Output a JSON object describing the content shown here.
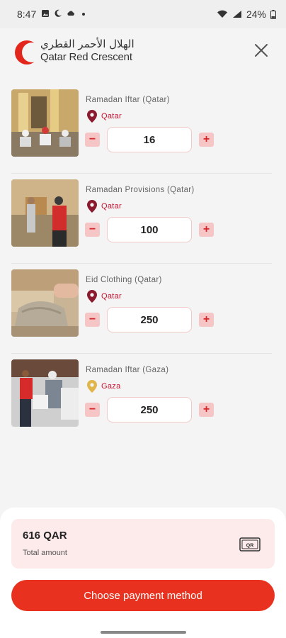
{
  "status_bar": {
    "time": "8:47",
    "battery": "24%"
  },
  "header": {
    "logo_ar": "الهلال الأحمر القطري",
    "logo_en": "Qatar Red Crescent"
  },
  "items": [
    {
      "title": "Ramadan Iftar (Qatar)",
      "location": "Qatar",
      "quantity": "16",
      "pin_color": "#8b1a2e"
    },
    {
      "title": "Ramadan Provisions (Qatar)",
      "location": "Qatar",
      "quantity": "100",
      "pin_color": "#8b1a2e"
    },
    {
      "title": "Eid Clothing (Qatar)",
      "location": "Qatar",
      "quantity": "250",
      "pin_color": "#8b1a2e"
    },
    {
      "title": "Ramadan Iftar (Gaza)",
      "location": "Gaza",
      "quantity": "250",
      "pin_color": "#e0b64b"
    }
  ],
  "summary": {
    "total_amount": "616 QAR",
    "total_label": "Total amount",
    "qr_label": "QR"
  },
  "pay_button": "Choose payment method",
  "colors": {
    "accent": "#e8321f",
    "pin_qatar": "#8b1a2e",
    "pin_gaza": "#e0b64b"
  }
}
